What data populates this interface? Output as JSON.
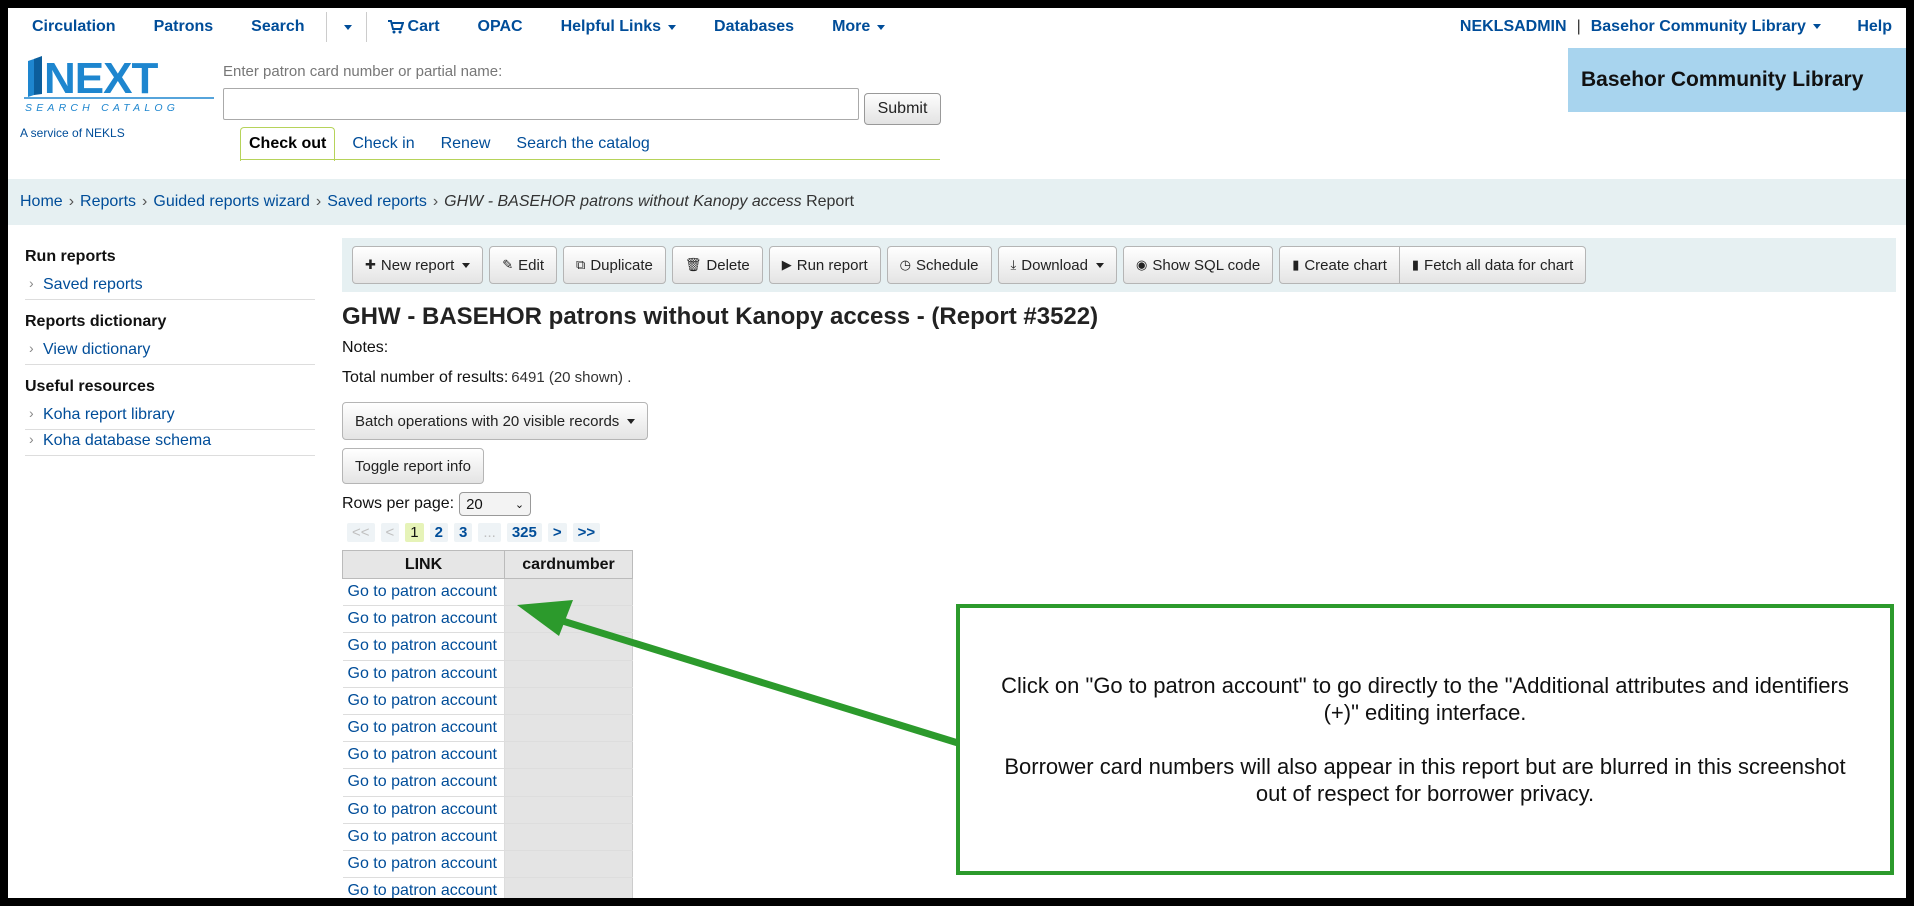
{
  "topnav": {
    "items": [
      {
        "label": "Circulation"
      },
      {
        "label": "Patrons"
      },
      {
        "label": "Search"
      }
    ],
    "cart_label": "Cart",
    "items2": [
      {
        "label": "OPAC"
      },
      {
        "label": "Helpful Links"
      },
      {
        "label": "Databases"
      },
      {
        "label": "More"
      }
    ],
    "user": "NEKLSADMIN",
    "separator": "|",
    "library": "Basehor Community Library",
    "help": "Help"
  },
  "header": {
    "logo_text": "NEXT",
    "logo_tagline": "SEARCH CATALOG",
    "logo_sub": "A service of NEKLS",
    "search_label": "Enter patron card number or partial name:",
    "search_value": "",
    "submit_label": "Submit",
    "tabs": [
      {
        "label": "Check out",
        "active": true
      },
      {
        "label": "Check in"
      },
      {
        "label": "Renew"
      },
      {
        "label": "Search the catalog"
      }
    ],
    "library_banner": "Basehor Community Library"
  },
  "breadcrumb": {
    "items": [
      "Home",
      "Reports",
      "Guided reports wizard",
      "Saved reports"
    ],
    "separator": "›",
    "current_italic": "GHW - BASEHOR patrons without Kanopy access",
    "current_suffix": "Report"
  },
  "sidebar": {
    "groups": [
      {
        "heading": "Run reports",
        "links": [
          "Saved reports"
        ]
      },
      {
        "heading": "Reports dictionary",
        "links": [
          "View dictionary"
        ]
      },
      {
        "heading": "Useful resources",
        "links": [
          "Koha report library",
          "Koha database schema"
        ]
      }
    ]
  },
  "toolbar": {
    "new_report": "New report",
    "edit": "Edit",
    "duplicate": "Duplicate",
    "delete": "Delete",
    "run_report": "Run report",
    "schedule": "Schedule",
    "download": "Download",
    "show_sql": "Show SQL code",
    "create_chart": "Create chart",
    "fetch_all": "Fetch all data for chart"
  },
  "report": {
    "title": "GHW - BASEHOR patrons without Kanopy access - (Report #3522)",
    "notes_label": "Notes:",
    "total_label": "Total number of results:",
    "total_value": "6491 (20 shown) .",
    "batch_label": "Batch operations with 20 visible records",
    "toggle_label": "Toggle report info",
    "rows_label": "Rows per page:",
    "rows_value": "20"
  },
  "pager": {
    "first": "<<",
    "prev": "<",
    "pages": [
      "1",
      "2",
      "3"
    ],
    "ellipsis": "...",
    "last_page": "325",
    "next": ">",
    "last": ">>"
  },
  "table": {
    "columns": [
      "LINK",
      "cardnumber"
    ],
    "link_text": "Go to patron account",
    "rows_visible": 12
  },
  "callout": {
    "line1": "Click on \"Go to patron account\" to go directly to the \"Additional attributes and identifiers (+)\" editing interface.",
    "line2": "Borrower card numbers will also appear in this report but are blurred in this screenshot out of respect for borrower privacy."
  },
  "colors": {
    "link": "#004d99",
    "banner": "#a8d4ee",
    "breadcrumb_bg": "#e6f0f2",
    "callout_border": "#2c9a2c",
    "logo_blue": "#1e86cf"
  }
}
